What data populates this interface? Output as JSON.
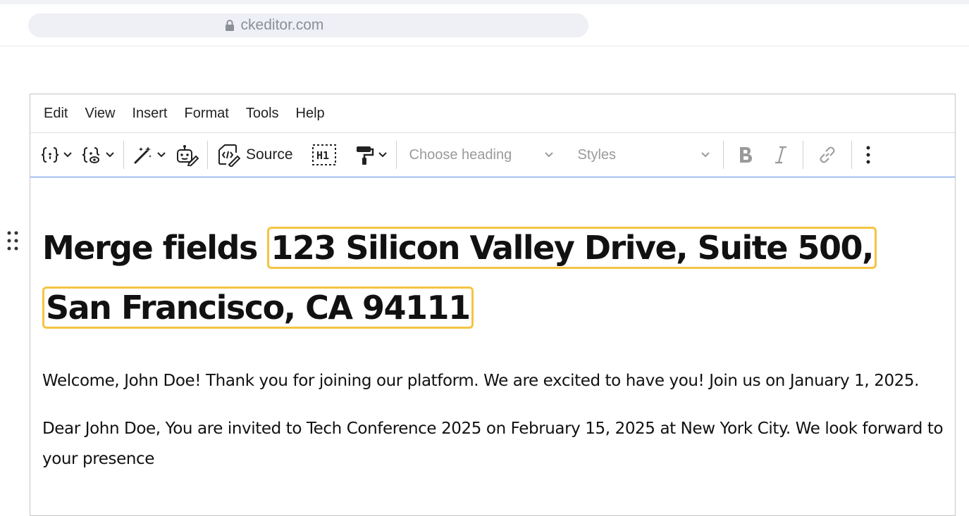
{
  "browser": {
    "url": "ckeditor.com"
  },
  "menubar": {
    "items": [
      {
        "label": "Edit"
      },
      {
        "label": "View"
      },
      {
        "label": "Insert"
      },
      {
        "label": "Format"
      },
      {
        "label": "Tools"
      },
      {
        "label": "Help"
      }
    ]
  },
  "toolbar": {
    "source_label": "Source",
    "heading_placeholder": "Choose heading",
    "styles_placeholder": "Styles"
  },
  "content": {
    "heading_prefix": "Merge fields",
    "merge_line1": "123 Silicon Valley Drive, Suite 500, San",
    "merge_line2": "Francisco, CA 94111",
    "paragraph1": "Welcome, John Doe! Thank you for joining our platform. We are excited to have you! Join us on January 1, 2025.",
    "paragraph2": "Dear John Doe, You are invited to Tech Conference 2025 on February 15, 2025 at New York City. We look forward to your presence"
  },
  "colors": {
    "merge_field_border": "#f5c443",
    "focus_border": "#5b8ee6"
  }
}
